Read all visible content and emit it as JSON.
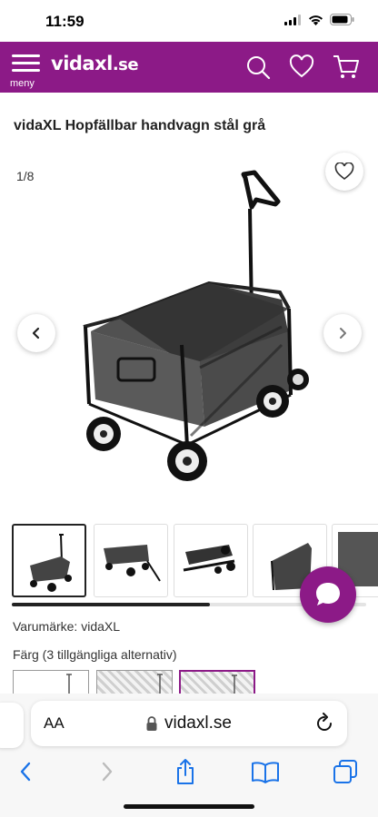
{
  "status": {
    "time": "11:59"
  },
  "header": {
    "menu_label": "meny",
    "logo_text": "vidaxl",
    "logo_suffix": ".se",
    "brand_color": "#8c1a87"
  },
  "product": {
    "title": "vidaXL Hopfällbar handvagn stål grå",
    "image_counter": "1/8",
    "brand_line": "Varumärke: vidaXL",
    "color_line": "Färg (3 tillgängliga alternativ)"
  },
  "gallery": {
    "scroll_progress": 0.56
  },
  "browser": {
    "text_size_label": "AA",
    "url": "vidaxl.se"
  },
  "icons": {
    "search": "search-icon",
    "wishlist": "heart-icon",
    "cart": "cart-icon",
    "chat": "chat-bubble-icon"
  }
}
